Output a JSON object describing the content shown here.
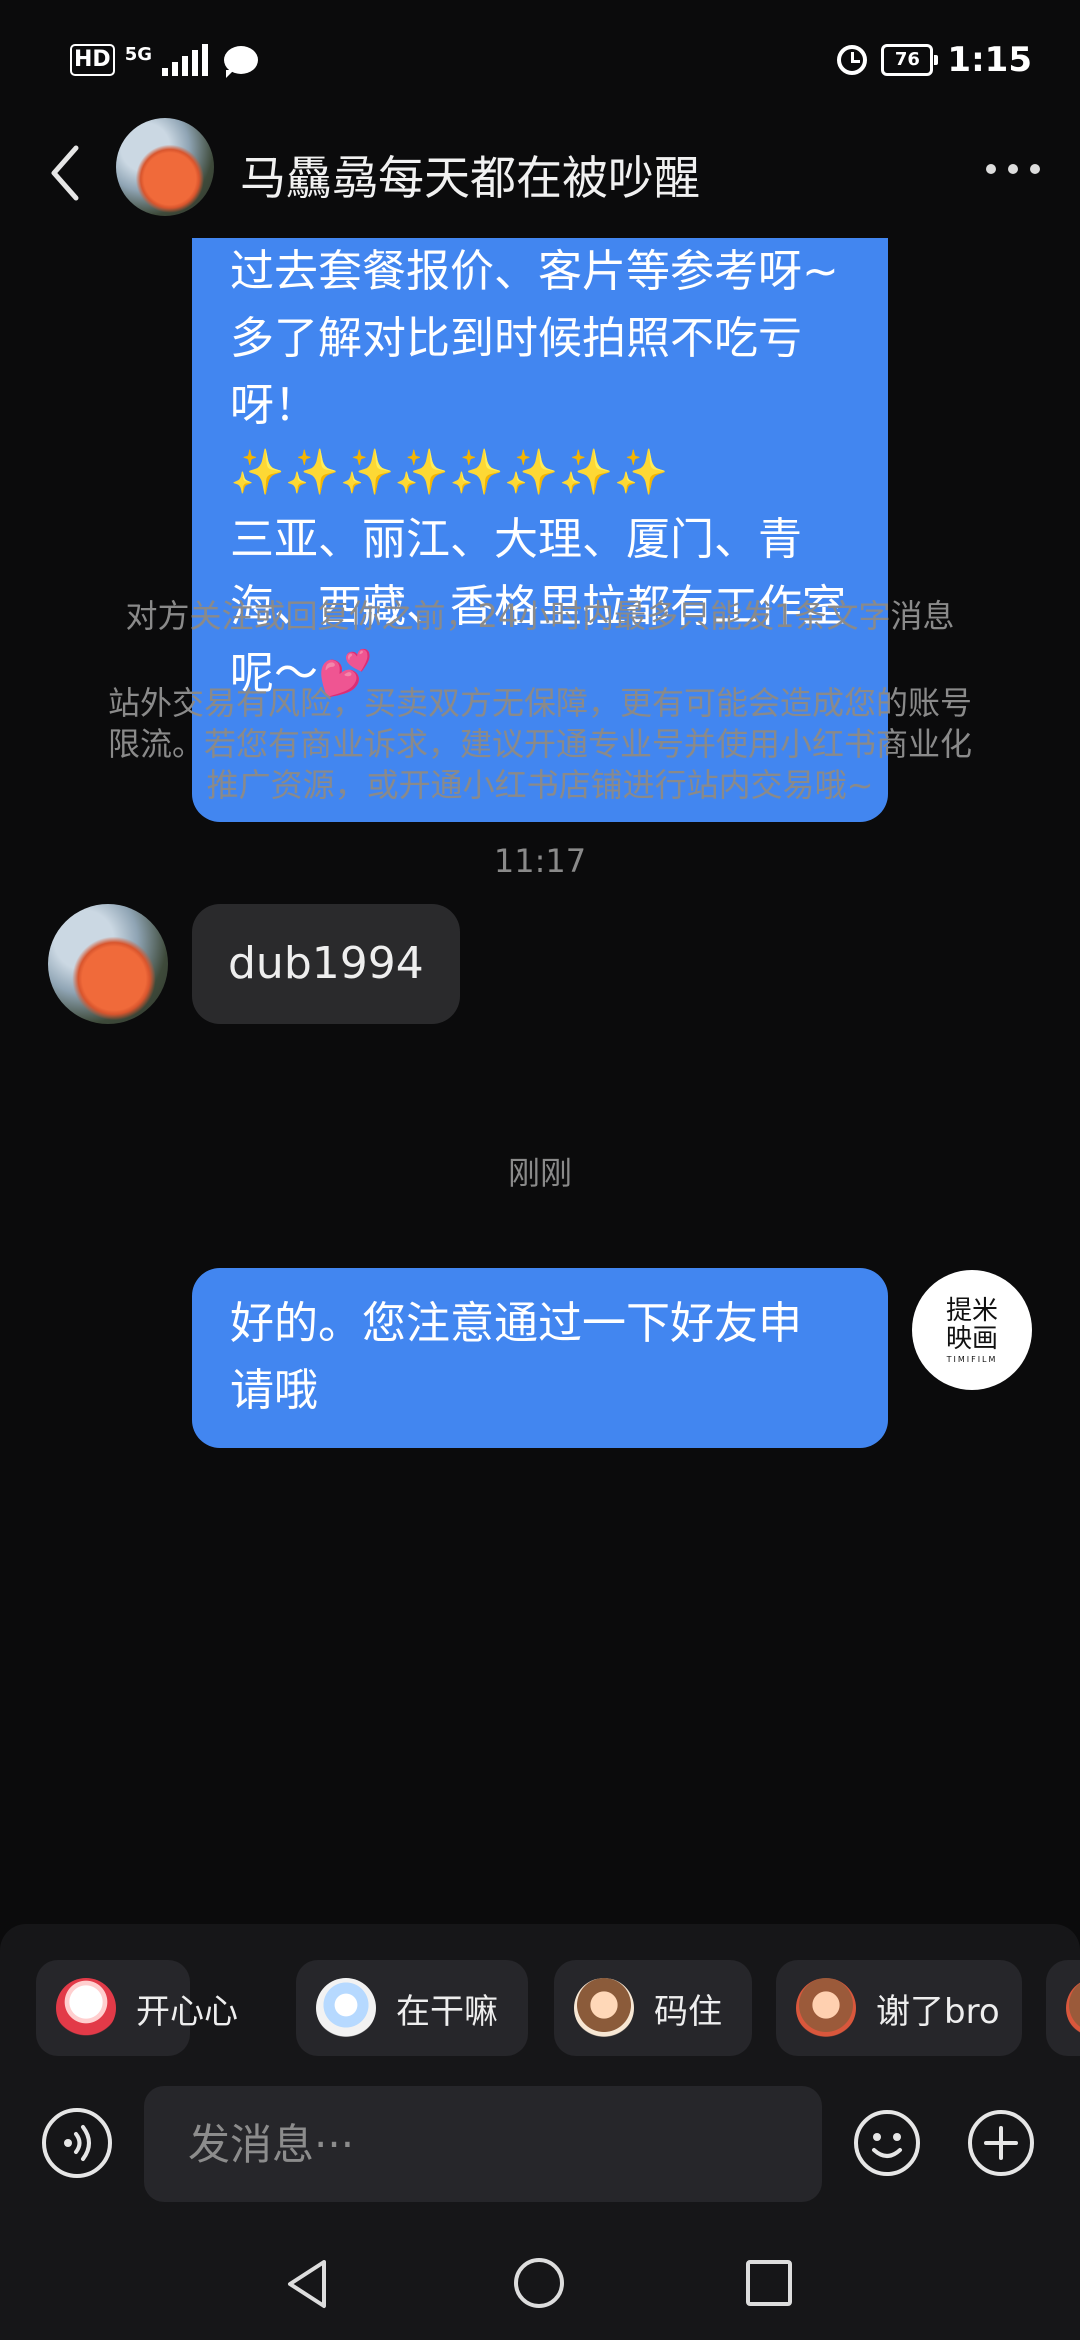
{
  "status_bar": {
    "hd": "HD",
    "network": "5G",
    "battery": "76",
    "time": "1:15"
  },
  "header": {
    "contact_name": "马驫骉每天都在被吵醒"
  },
  "messages": {
    "outgoing_long_lines": [
      "过去套餐报价、客片等参考呀~",
      "多了解对比到时候拍照不吃亏呀！",
      "✨✨✨✨✨✨✨✨",
      "三亚、丽江、大理、厦门、青海、西藏、香格里拉都有工作室呢～💕"
    ],
    "system_note_1": "对方关注或回复你之前，24小时内最多只能发1条文字消息",
    "system_note_2": "站外交易有风险，买卖双方无保障，更有可能会造成您的账号限流。若您有商业诉求，建议开通专业号并使用小红书商业化推广资源，或开通小红书店铺进行站内交易哦~",
    "timestamp_1": "11:17",
    "incoming_text": "dub1994",
    "timestamp_2": "刚刚",
    "outgoing_last_line1": "好的。您注意通过一下好友申",
    "outgoing_last_line2": "请哦",
    "my_avatar_line1": "提米",
    "my_avatar_line2": "映画",
    "my_avatar_sub": "TIMIFILM"
  },
  "quick_replies": [
    {
      "label": "开心心",
      "sticker": "happy-sticker-icon"
    },
    {
      "label": "在干嘛",
      "sticker": "curious-sticker-icon"
    },
    {
      "label": "码住",
      "sticker": "bookmark-sticker-icon"
    },
    {
      "label": "谢了bro",
      "sticker": "thanks-sticker-icon"
    }
  ],
  "input": {
    "placeholder": "发消息···"
  },
  "colors": {
    "background": "#0b0b0c",
    "outgoing_bubble": "#4286f0",
    "incoming_bubble": "#2a2a2c",
    "system_text": "#8a8a8a"
  }
}
